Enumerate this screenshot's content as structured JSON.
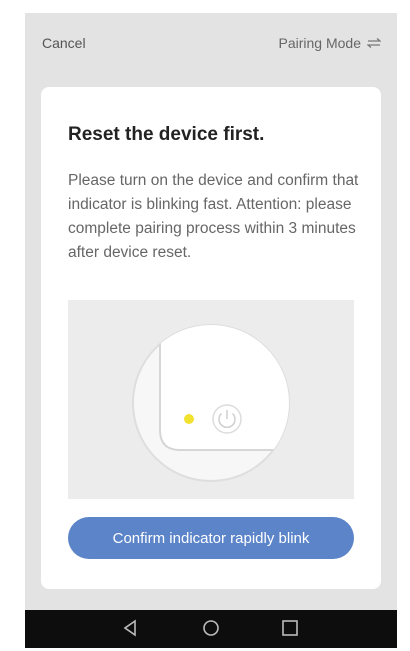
{
  "header": {
    "cancel_label": "Cancel",
    "mode_label": "Pairing Mode",
    "mode_icon": "swap-icon"
  },
  "card": {
    "title": "Reset the device first.",
    "description": "Please turn on the device and confirm that indicator is blinking fast. Attention: please complete pairing process within 3 minutes after device reset.",
    "illustration": {
      "indicator_color": "#f2e230",
      "power_icon": "power-icon"
    },
    "confirm_button_label": "Confirm indicator rapidly blink"
  },
  "navbar": {
    "icons": [
      "back-icon",
      "home-icon",
      "recents-icon"
    ]
  },
  "colors": {
    "accent": "#5b84c9",
    "background": "#e3e3e3",
    "nav_bar": "#0d0d0d"
  }
}
